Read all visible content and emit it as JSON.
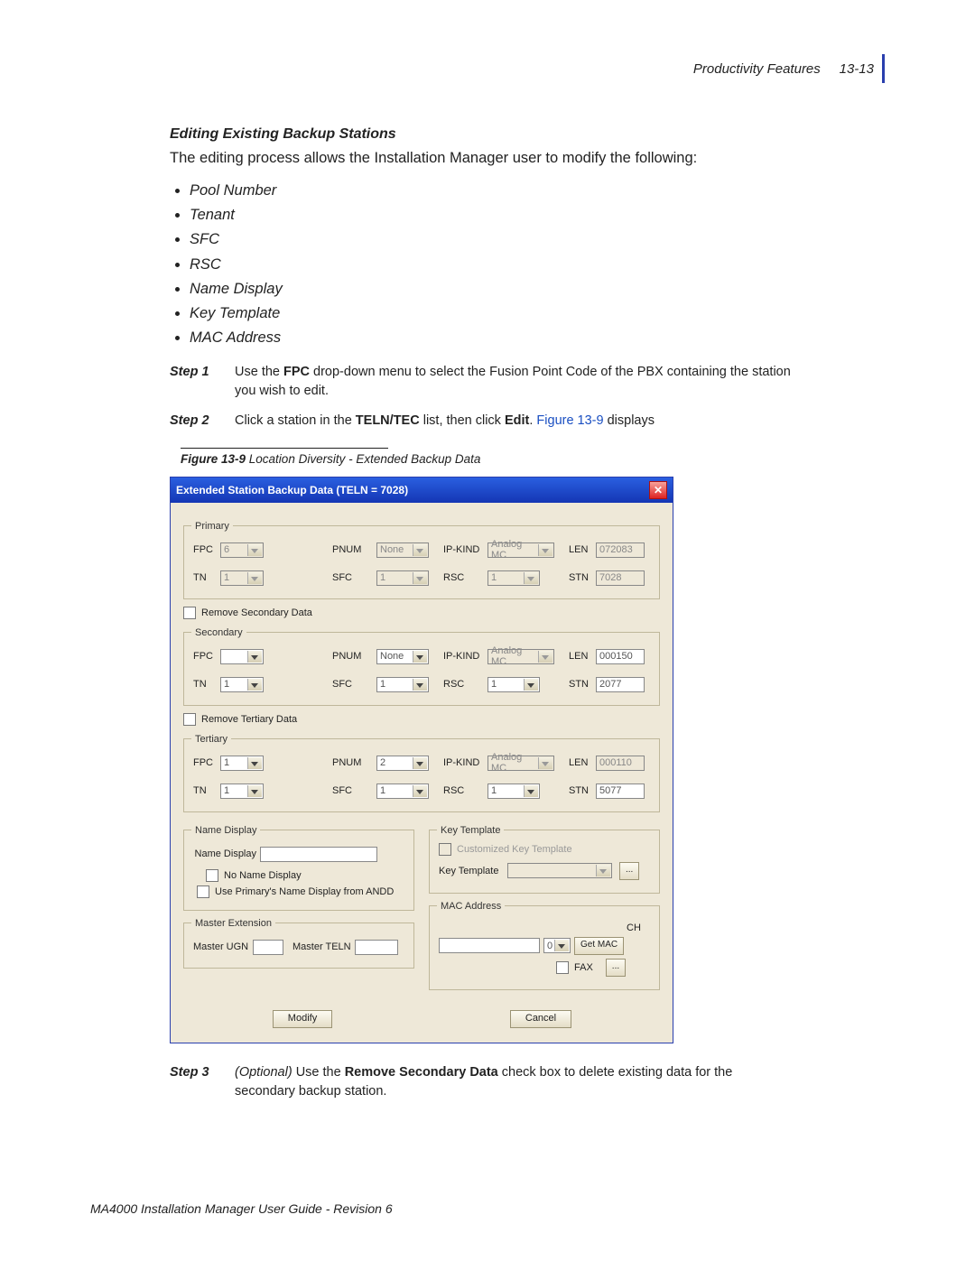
{
  "header": {
    "section": "Productivity Features",
    "page": "13-13"
  },
  "title": "Editing Existing Backup Stations",
  "intro": "The editing process allows the Installation Manager user to modify the following:",
  "bullets": [
    "Pool Number",
    "Tenant",
    "SFC",
    "RSC",
    "Name Display",
    "Key Template",
    "MAC Address"
  ],
  "steps": {
    "s1_label": "Step 1",
    "s1_pre": "Use the ",
    "s1_bold": "FPC",
    "s1_post": " drop-down menu to select the Fusion Point Code of the PBX containing the station you wish to edit.",
    "s2_label": "Step 2",
    "s2_pre": "Click a station in the ",
    "s2_bold": "TELN/TEC",
    "s2_mid": " list, then click ",
    "s2_bold2": "Edit",
    "s2_post": ". ",
    "s2_link": "Figure 13-9",
    "s2_tail": " displays",
    "s3_label": "Step 3",
    "s3_opt": "(Optional) ",
    "s3_pre": "Use the ",
    "s3_bold": "Remove Secondary Data",
    "s3_post": " check box to delete existing data for the secondary backup station."
  },
  "figcap": {
    "num": "Figure 13-9",
    "text": "  Location Diversity - Extended Backup Data"
  },
  "dialog": {
    "title": "Extended Station Backup Data (TELN = 7028)",
    "legends": {
      "primary": "Primary",
      "secondary": "Secondary",
      "tertiary": "Tertiary",
      "name": "Name Display",
      "master": "Master Extension",
      "key": "Key Template",
      "mac": "MAC Address"
    },
    "labels": {
      "fpc": "FPC",
      "tn": "TN",
      "pnum": "PNUM",
      "sfc": "SFC",
      "ipkind": "IP-KIND",
      "rsc": "RSC",
      "len": "LEN",
      "stn": "STN",
      "remove_sec": "Remove Secondary Data",
      "remove_ter": "Remove Tertiary Data",
      "namedisp": "Name Display",
      "noname": "No Name Display",
      "useprim": "Use Primary's Name Display from ANDD",
      "mugn": "Master UGN",
      "mteln": "Master TELN",
      "custkey": "Customized Key Template",
      "keytmpl": "Key Template",
      "ch": "CH",
      "getmac": "Get MAC",
      "fax": "FAX",
      "modify": "Modify",
      "cancel": "Cancel"
    },
    "values": {
      "p_fpc": "6",
      "p_tn": "1",
      "p_pnum": "None",
      "p_sfc": "1",
      "p_ipkind": "Analog MC",
      "p_rsc": "1",
      "p_len": "072083",
      "p_stn": "7028",
      "s_fpc": "",
      "s_tn": "1",
      "s_pnum": "None",
      "s_sfc": "1",
      "s_ipkind": "Analog MC",
      "s_rsc": "1",
      "s_len": "000150",
      "s_stn": "2077",
      "t_fpc": "1",
      "t_tn": "1",
      "t_pnum": "2",
      "t_sfc": "1",
      "t_ipkind": "Analog MC",
      "t_rsc": "1",
      "t_len": "000110",
      "t_stn": "5077",
      "ch": "0"
    }
  },
  "footer": "MA4000 Installation Manager User Guide - Revision 6"
}
